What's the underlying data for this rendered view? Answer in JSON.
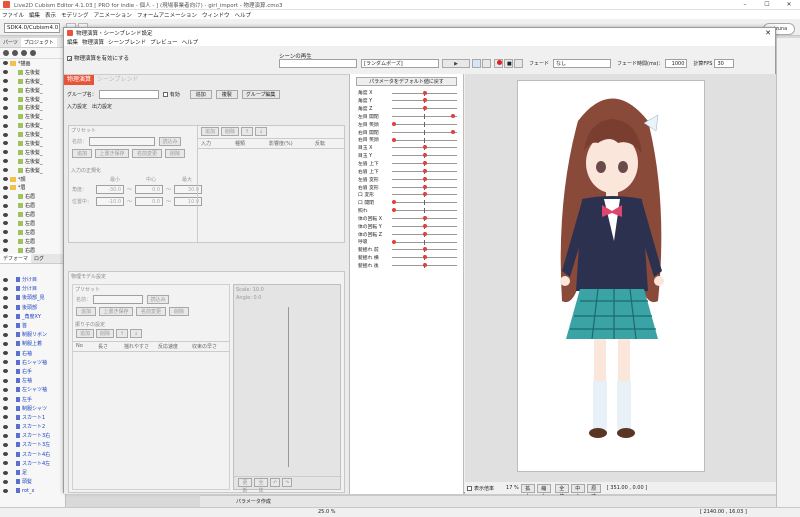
{
  "app": {
    "title": "Live2D Cubism Editor 4.1.03  [ PRO for indie - 個人 - ] (現場事業者向け)  - girl_import - 物理演算.cmo3",
    "menu": [
      "ファイル",
      "編集",
      "表示",
      "モデリング",
      "アニメーション",
      "フォームアニメーション",
      "ウィンドウ",
      "ヘルプ"
    ],
    "sdk_select": "SDK4.0/Cubism4.0",
    "logo_text": "aizuna"
  },
  "left_panel": {
    "tabs": [
      "パーツ",
      "プロジェクト"
    ],
    "parts": [
      {
        "label": "*描画",
        "type": "folder"
      },
      {
        "label": "左後髪",
        "type": "art"
      },
      {
        "label": "右後髪_",
        "type": "art"
      },
      {
        "label": "右後髪_",
        "type": "art"
      },
      {
        "label": "左後髪_",
        "type": "art"
      },
      {
        "label": "右後髪_",
        "type": "art"
      },
      {
        "label": "左後髪_",
        "type": "art"
      },
      {
        "label": "右後髪_",
        "type": "art"
      },
      {
        "label": "左後髪_",
        "type": "art"
      },
      {
        "label": "左後髪_",
        "type": "art"
      },
      {
        "label": "左後髪_",
        "type": "art"
      },
      {
        "label": "左後髪_",
        "type": "art"
      },
      {
        "label": "右後髪_",
        "type": "art"
      },
      {
        "label": "*顔",
        "type": "folder"
      },
      {
        "label": "*眉",
        "type": "folder"
      },
      {
        "label": "右眉",
        "type": "art"
      },
      {
        "label": "右眉",
        "type": "art"
      },
      {
        "label": "右眉",
        "type": "art"
      },
      {
        "label": "左眉",
        "type": "art"
      },
      {
        "label": "左眉",
        "type": "art"
      },
      {
        "label": "左眉",
        "type": "art"
      },
      {
        "label": "右眉",
        "type": "art"
      },
      {
        "label": "左眉",
        "type": "art"
      }
    ],
    "deformer_tabs": [
      "デフォーマ",
      "ログ"
    ],
    "deformers": [
      "分け目",
      "分け目",
      "後頭部_見",
      "後頭部",
      "_角度XY",
      "首",
      "制服リボン",
      "制服上着",
      "右袖",
      "右シャツ袖",
      "右手",
      "左袖",
      "左シャツ袖",
      "左手",
      "制服シャツ",
      "スカート1",
      "スカート2",
      "スカート3右",
      "スカート3左",
      "スカート4右",
      "スカート4左",
      "足",
      "頭髪",
      "rot_x"
    ]
  },
  "dialog": {
    "title": "物理演算・シーンブレンド設定",
    "menu": [
      "編集",
      "物理演算",
      "シーンブレンド",
      "プレビュー",
      "ヘルプ"
    ],
    "enable_physics_label": "物理演算を有効にする",
    "scene_label": "シーンの再生",
    "scene_select": "",
    "random_pose": "[ランダムポーズ]",
    "fade_label": "フェード",
    "fade_value": "なし",
    "fade_time_label": "フェード時間(ms)：",
    "fade_time_value": "1000",
    "fps_label": "計算FPS",
    "fps_value": "30",
    "tabs": [
      "物理演算",
      "シーンブレンド"
    ],
    "group_label": "グループ名：",
    "enabled_label": "有効",
    "buttons": [
      "追加",
      "複製",
      "グループ編集"
    ],
    "io_tabs": [
      "入力設定",
      "出力設定"
    ],
    "preset_label": "プリセット",
    "name_label": "名前：",
    "read_label": "読込み",
    "preset_buttons": [
      "追加",
      "上書き保存",
      "名前変更",
      "削除"
    ],
    "input_headers": [
      "入力",
      "種類",
      "影響度(%)",
      "反転"
    ],
    "add_delete": [
      "追加",
      "削除"
    ],
    "normalize_label": "入力の正規化",
    "norm_headers": [
      "最小",
      "中心",
      "最大"
    ],
    "angle_label": "角度：",
    "angle_values": [
      "-30.0",
      "0.0",
      "30.0"
    ],
    "position_label": "位置中：",
    "position_values": [
      "-10.0",
      "0.0",
      "10.0"
    ],
    "pendulum_section": "物理モデル設定",
    "pendulum_preset": "プリセット",
    "pendulum_name": "名前：",
    "pendulum_read": "読込み",
    "pendulum_buttons": [
      "追加",
      "上書き保存",
      "名前変更",
      "削除"
    ],
    "pendulum_sub": "振り子の設定",
    "pendulum_sub_buttons": [
      "追加",
      "削除"
    ],
    "pendulum_headers": [
      "No",
      "長さ",
      "揺れやすさ",
      "反応速度",
      "収束の早さ"
    ],
    "scale_label": "Scale: 10.0",
    "angle_info": "Angle: 0.0",
    "footer_buttons": [
      "更新",
      "全体"
    ],
    "param_reset": "パラメータをデフォルト値に戻す",
    "params": [
      {
        "name": "角度 X",
        "knob": 0.5
      },
      {
        "name": "角度 Y",
        "knob": 0.5
      },
      {
        "name": "角度 Z",
        "knob": 0.5
      },
      {
        "name": "左目 開閉",
        "knob": 0.97
      },
      {
        "name": "左目 笑顔",
        "knob": 0.0
      },
      {
        "name": "右目 開閉",
        "knob": 0.97
      },
      {
        "name": "右目 笑顔",
        "knob": 0.0
      },
      {
        "name": "目玉 X",
        "knob": 0.5
      },
      {
        "name": "目玉 Y",
        "knob": 0.5
      },
      {
        "name": "左眉 上下",
        "knob": 0.5
      },
      {
        "name": "右眉 上下",
        "knob": 0.5
      },
      {
        "name": "左眉 変形",
        "knob": 0.5
      },
      {
        "name": "右眉 変形",
        "knob": 0.5
      },
      {
        "name": "口 変形",
        "knob": 0.5
      },
      {
        "name": "口 開閉",
        "knob": 0.0
      },
      {
        "name": "照れ",
        "knob": 0.0
      },
      {
        "name": "体の回転 X",
        "knob": 0.5
      },
      {
        "name": "体の回転 Y",
        "knob": 0.5
      },
      {
        "name": "体の回転 Z",
        "knob": 0.5
      },
      {
        "name": "呼吸",
        "knob": 0.0
      },
      {
        "name": "髪揺れ 前",
        "knob": 0.5
      },
      {
        "name": "髪揺れ 横",
        "knob": 0.5
      },
      {
        "name": "髪揺れ 後",
        "knob": 0.5
      }
    ],
    "canvas": {
      "display_scale_label": "表示倍率",
      "zoom": "17 %",
      "buttons": [
        "拡大",
        "縮小",
        "全体",
        "中心",
        "原寸"
      ],
      "coords": "[ 351.00 ,   0.00 ]"
    }
  },
  "status": {
    "zoom": "25.0 %",
    "coords": "[ 2140.00 ,   16.03 ]",
    "add_param": "パラメータ作成"
  }
}
